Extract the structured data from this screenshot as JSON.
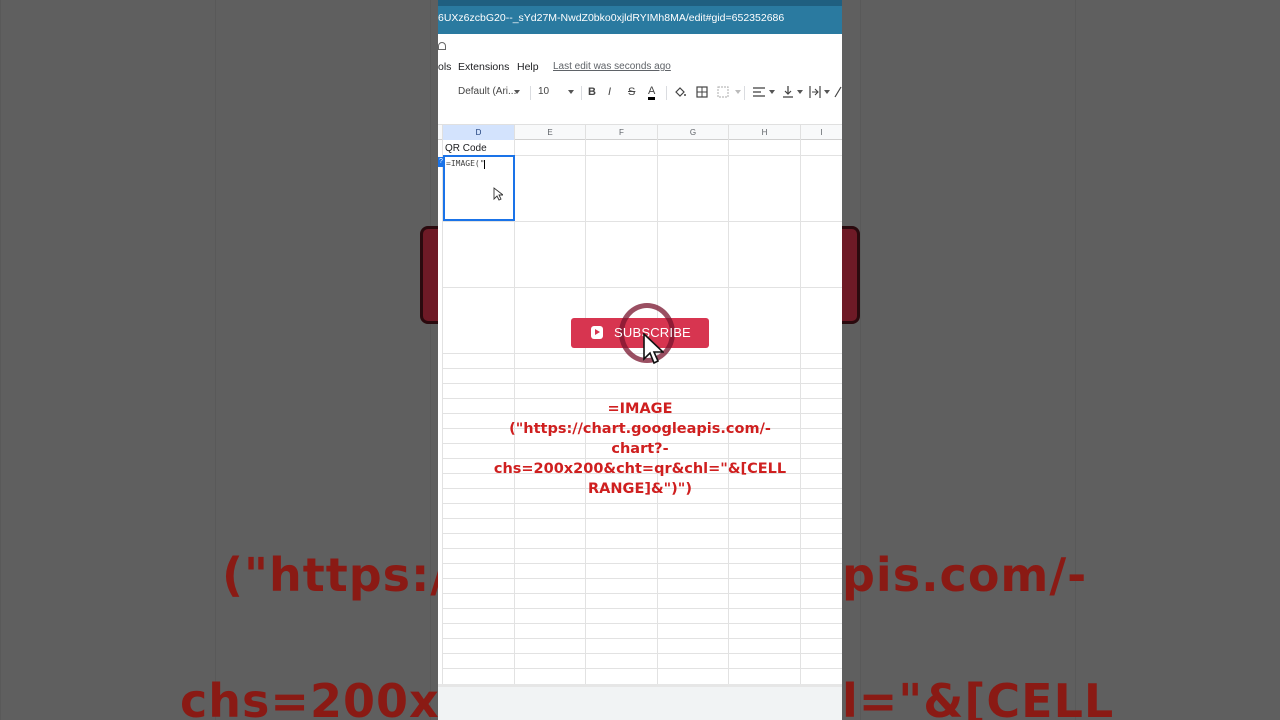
{
  "window": {
    "url": "6UXz6zcbG20--_sYd27M-NwdZ0bko0xjldRYIMh8MA/edit#gid=652352686"
  },
  "menu": {
    "items": [
      "ols",
      "Extensions",
      "Help"
    ],
    "last_edit": "Last edit was seconds ago"
  },
  "toolbar": {
    "font_name": "Default (Ari...",
    "font_size": "10",
    "bold": "B",
    "italic": "I",
    "strike": "S",
    "text_color": "A"
  },
  "sheet": {
    "columns": [
      "D",
      "E",
      "F",
      "G",
      "H",
      "I"
    ],
    "header_cell": "QR Code",
    "active_cell_value": "=IMAGE(\"",
    "fx_badge": "?"
  },
  "overlay": {
    "subscribe_label": "SUBSCRIBE",
    "formula_lines": [
      "=IMAGE",
      "(\"https://chart.googleapis.com/-",
      "chart?-",
      "chs=200x200&cht=qr&chl=\"&[CELL",
      "RANGE]&\")\")"
    ]
  },
  "background_text": {
    "line1": "(\"https://",
    "line1b": "pis.com/-",
    "line2": "chs=200x",
    "line2b": "l=\"&[CELL"
  },
  "colors": {
    "accent": "#1a73e8",
    "subscribe": "#d73550",
    "formula_red": "#cf1f1f",
    "urlbar": "#2a7aa0"
  }
}
